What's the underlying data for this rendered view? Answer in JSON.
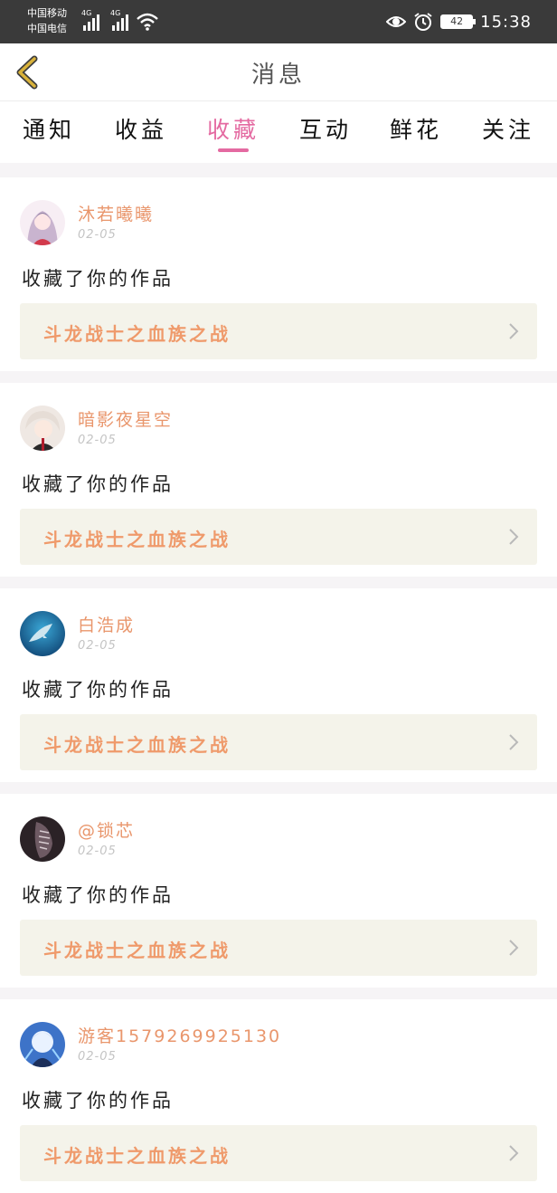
{
  "status_bar": {
    "carrier_1": "中国移动",
    "carrier_2": "中国电信",
    "network_1": "4G",
    "network_2": "4G",
    "battery": "42",
    "time": "15:38",
    "icons": [
      "signal-icon",
      "wifi-icon",
      "eye-icon",
      "alarm-icon",
      "battery-icon"
    ]
  },
  "header": {
    "title": "消息",
    "back_icon": "chevron-left-icon"
  },
  "tabs": [
    {
      "label": "通知",
      "active": false
    },
    {
      "label": "收益",
      "active": false
    },
    {
      "label": "收藏",
      "active": true
    },
    {
      "label": "互动",
      "active": false
    },
    {
      "label": "鲜花",
      "active": false
    },
    {
      "label": "关注",
      "active": false
    }
  ],
  "notifications": [
    {
      "username": "沐若曦曦",
      "date": "02-05",
      "action": "收藏了你的作品",
      "work_title": "斗龙战士之血族之战",
      "avatar": "anime-girl-avatar"
    },
    {
      "username": "暗影夜星空",
      "date": "02-05",
      "action": "收藏了你的作品",
      "work_title": "斗龙战士之血族之战",
      "avatar": "anime-boy-avatar"
    },
    {
      "username": "白浩成",
      "date": "02-05",
      "action": "收藏了你的作品",
      "work_title": "斗龙战士之血族之战",
      "avatar": "dolphin-avatar"
    },
    {
      "username": "@锁芯",
      "date": "02-05",
      "action": "收藏了你的作品",
      "work_title": "斗龙战士之血族之战",
      "avatar": "dark-photo-avatar"
    },
    {
      "username": "游客1579269925130",
      "date": "02-05",
      "action": "收藏了你的作品",
      "work_title": "斗龙战士之血族之战",
      "avatar": "anime-blue-avatar"
    }
  ],
  "colors": {
    "accent_pink": "#e46aa1",
    "username_orange": "#e9966c",
    "work_title_orange": "#ef9a6b",
    "work_link_bg": "#f4f3ea",
    "back_icon_gold": "#d9b23a",
    "status_bar_bg": "#3a3a3a"
  }
}
